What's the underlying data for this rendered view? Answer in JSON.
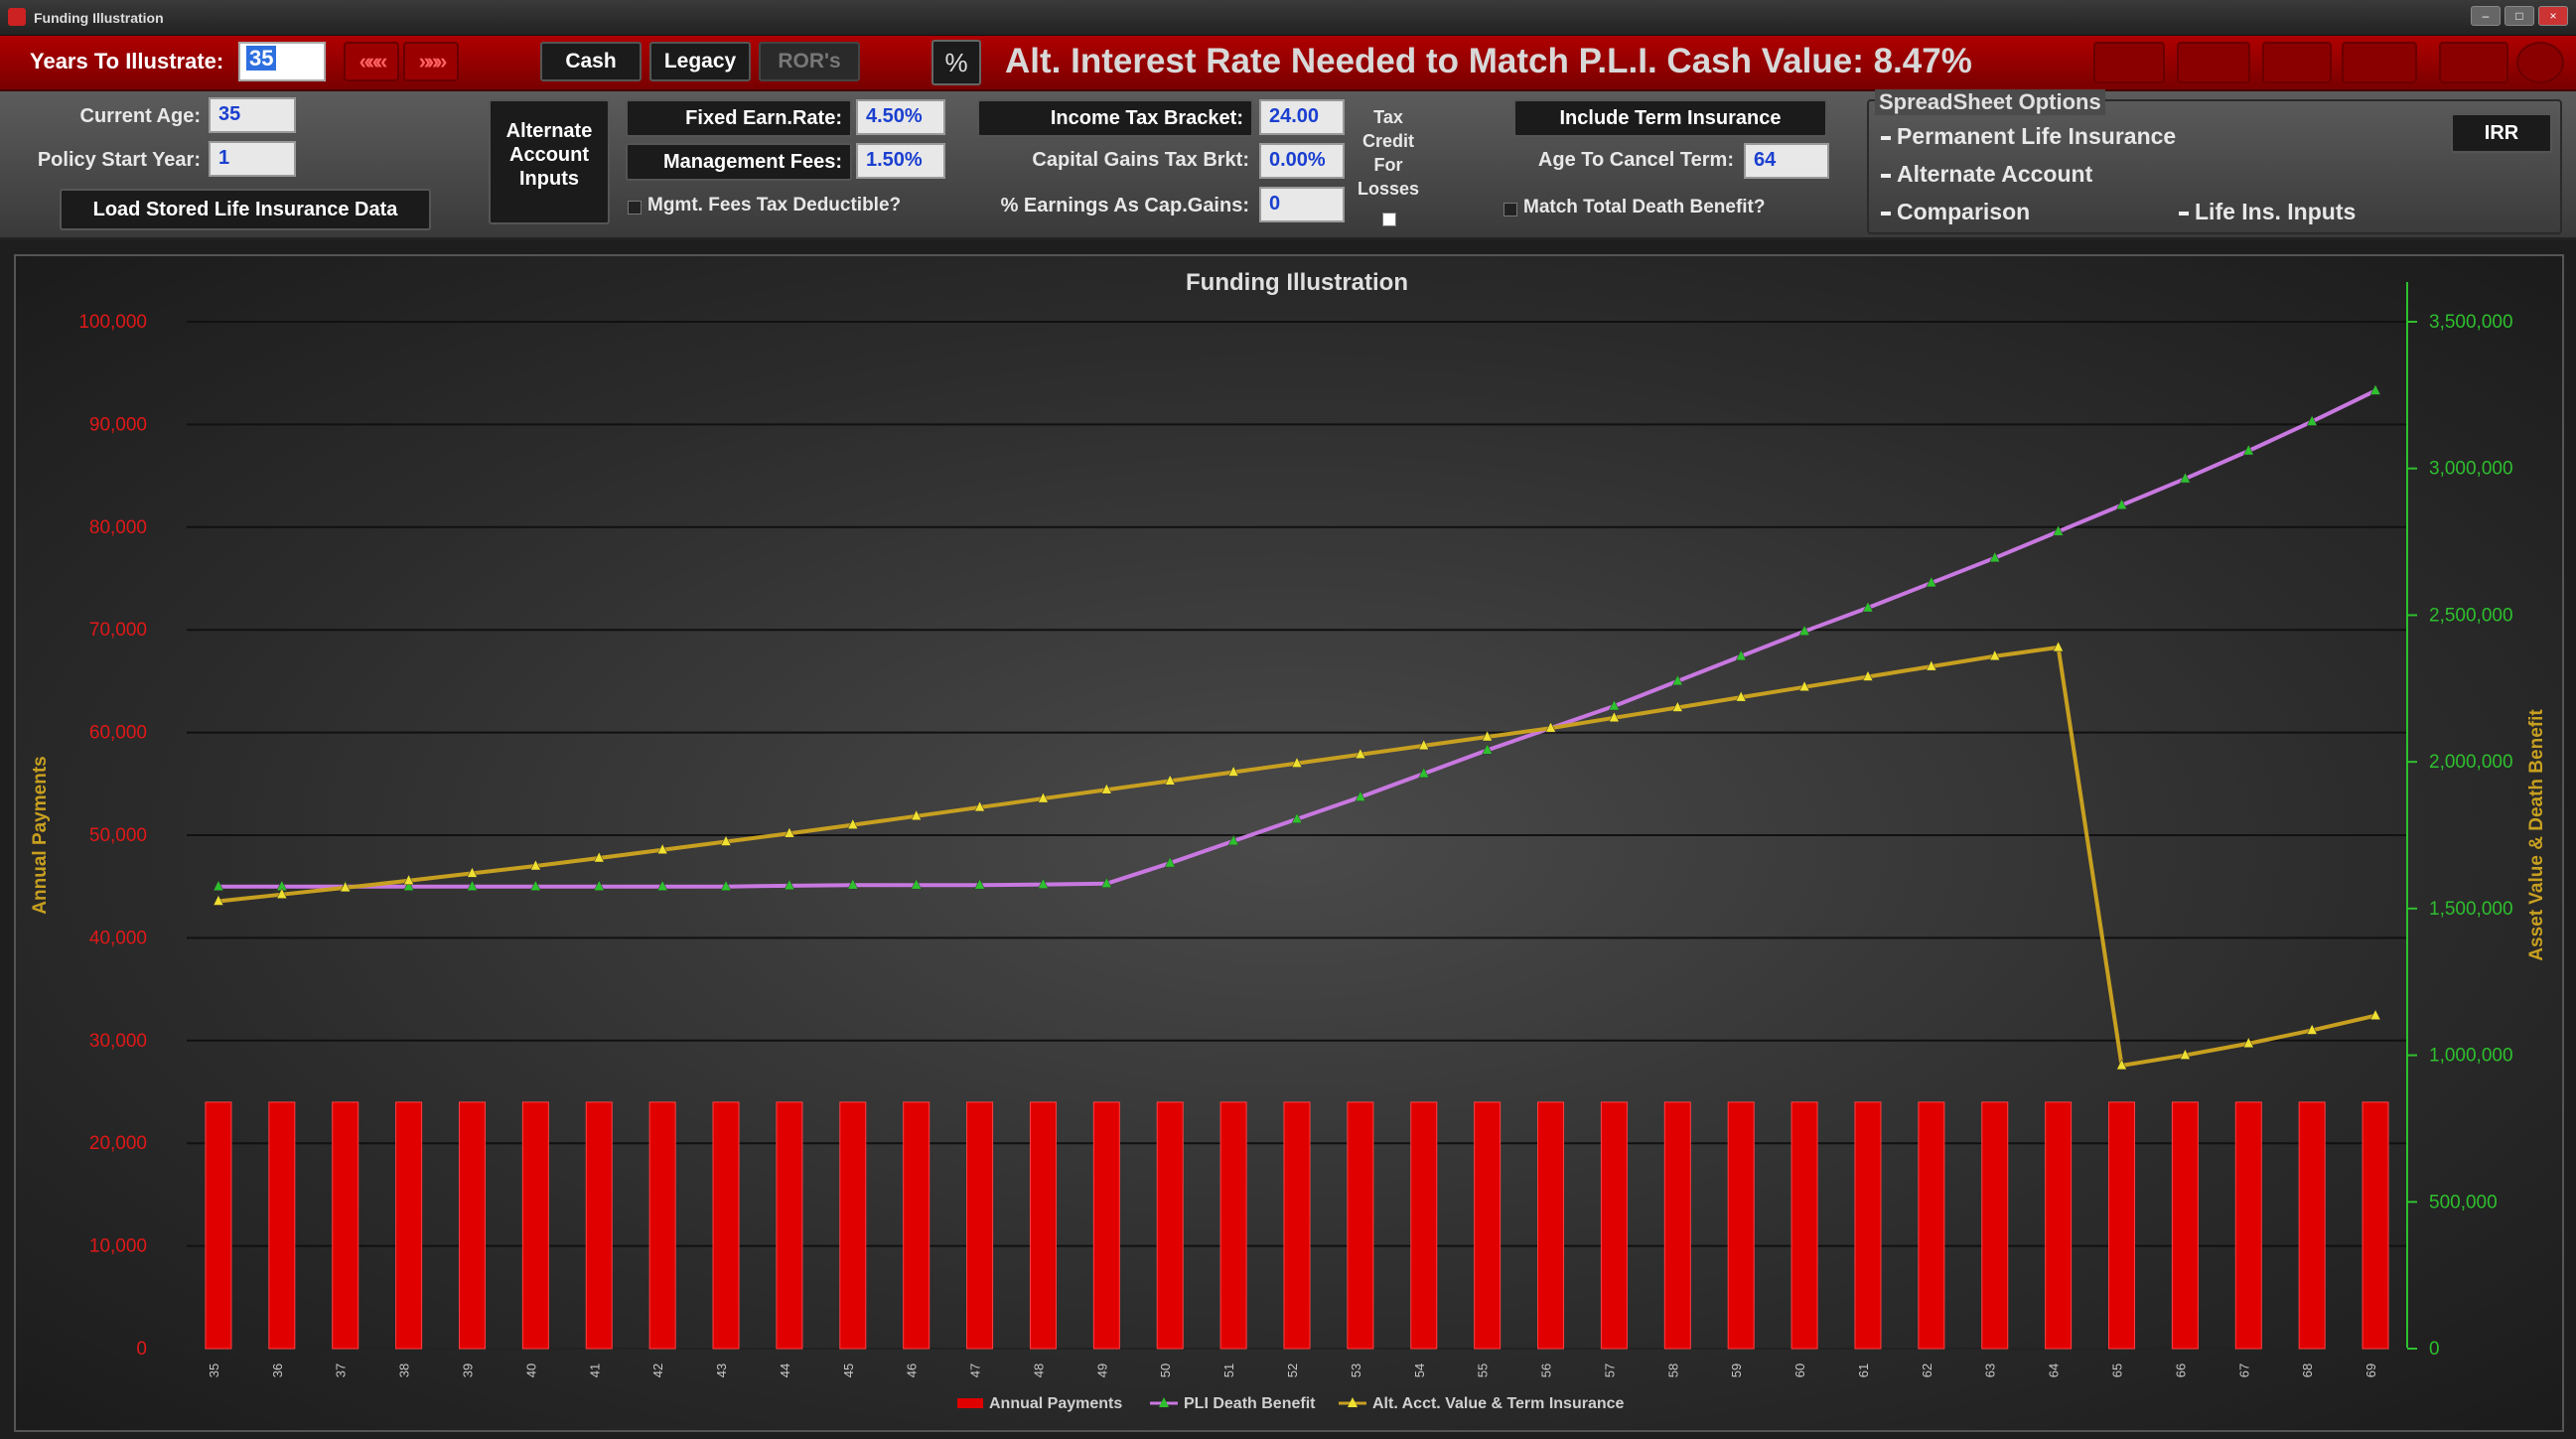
{
  "window": {
    "title": "Funding Illustration"
  },
  "toolbar": {
    "years_label": "Years To Illustrate:",
    "years_value": "35",
    "prev_icon": "«««",
    "next_icon": "»»»",
    "tabs": [
      "Cash",
      "Legacy",
      "ROR's"
    ],
    "pct_icon": "%",
    "headline": "Alt. Interest Rate Needed to Match P.L.I. Cash Value: 8.47%"
  },
  "panel": {
    "current_age_label": "Current Age:",
    "current_age_value": "35",
    "policy_start_label": "Policy Start Year:",
    "policy_start_value": "1",
    "load_button": "Load Stored Life Insurance Data",
    "alt_inputs_lines": [
      "Alternate",
      "Account",
      "Inputs"
    ],
    "fixed_earn_label": "Fixed Earn.Rate:",
    "fixed_earn_value": "4.50%",
    "mgmt_fees_label": "Management Fees:",
    "mgmt_fees_value": "1.50%",
    "mgmt_deductible_label": "Mgmt. Fees Tax Deductible?",
    "income_tax_label": "Income Tax Bracket:",
    "income_tax_value": "24.00",
    "cap_gains_label": "Capital Gains Tax Brkt:",
    "cap_gains_value": "0.00%",
    "earnings_cap_label": "% Earnings As Cap.Gains:",
    "earnings_cap_value": "0",
    "tax_credit_lines": [
      "Tax",
      "Credit",
      "For",
      "Losses"
    ],
    "include_term_label": "Include Term Insurance",
    "age_cancel_label": "Age To Cancel Term:",
    "age_cancel_value": "64",
    "match_death_label": "Match Total Death Benefit?",
    "ss_title": "SpreadSheet Options",
    "ss_options": [
      "Permanent Life Insurance",
      "Alternate Account",
      "Comparison",
      "Life Ins. Inputs"
    ],
    "irr_label": "IRR"
  },
  "chart_data": {
    "type": "bar+line",
    "title": "Funding Illustration",
    "ylabel": "Annual Payments",
    "y2label": "Asset Value & Death Benefit",
    "ylim": [
      0,
      100000
    ],
    "y2lim": [
      0,
      3500000
    ],
    "yticks": [
      "0",
      "10,000",
      "20,000",
      "30,000",
      "40,000",
      "50,000",
      "60,000",
      "70,000",
      "80,000",
      "90,000",
      "100,000"
    ],
    "y2ticks": [
      "0",
      "500,000",
      "1,000,000",
      "1,500,000",
      "2,000,000",
      "2,500,000",
      "3,000,000",
      "3,500,000"
    ],
    "categories": [
      "35",
      "36",
      "37",
      "38",
      "39",
      "40",
      "41",
      "42",
      "43",
      "44",
      "45",
      "46",
      "47",
      "48",
      "49",
      "50",
      "51",
      "52",
      "53",
      "54",
      "55",
      "56",
      "57",
      "58",
      "59",
      "60",
      "61",
      "62",
      "63",
      "64",
      "65",
      "66",
      "67",
      "68",
      "69"
    ],
    "colors": {
      "bars": "#e00000",
      "pli": "#c878e0",
      "alt": "#c8a020",
      "marker": "#2ec02e"
    },
    "legend": [
      "Annual Payments",
      "PLI Death Benefit",
      "Alt. Acct. Value & Term Insurance"
    ],
    "series": [
      {
        "name": "Annual Payments",
        "axis": "left",
        "kind": "bar",
        "values": [
          24000,
          24000,
          24000,
          24000,
          24000,
          24000,
          24000,
          24000,
          24000,
          24000,
          24000,
          24000,
          24000,
          24000,
          24000,
          24000,
          24000,
          24000,
          24000,
          24000,
          24000,
          24000,
          24000,
          24000,
          24000,
          24000,
          24000,
          24000,
          24000,
          24000,
          24000,
          24000,
          24000,
          24000,
          24000
        ]
      },
      {
        "name": "PLI Death Benefit",
        "axis": "right",
        "kind": "line",
        "values": [
          1575000,
          1575000,
          1575000,
          1575000,
          1575000,
          1575000,
          1575000,
          1575000,
          1575000,
          1578000,
          1580000,
          1580000,
          1580000,
          1582000,
          1585000,
          1655000,
          1730000,
          1805000,
          1880000,
          1960000,
          2040000,
          2115000,
          2190000,
          2275000,
          2360000,
          2445000,
          2525000,
          2610000,
          2695000,
          2785000,
          2875000,
          2965000,
          3060000,
          3160000,
          3265000
        ]
      },
      {
        "name": "Alt. Acct. Value & Term Insurance",
        "axis": "right",
        "kind": "line",
        "values": [
          1525000,
          1548000,
          1571000,
          1595000,
          1620000,
          1645000,
          1672000,
          1700000,
          1728000,
          1756000,
          1785000,
          1815000,
          1845000,
          1875000,
          1905000,
          1935000,
          1965000,
          1995000,
          2025000,
          2055000,
          2085000,
          2115000,
          2150000,
          2185000,
          2220000,
          2255000,
          2290000,
          2325000,
          2360000,
          2390000,
          965000,
          1000000,
          1040000,
          1085000,
          1135000
        ]
      }
    ]
  }
}
